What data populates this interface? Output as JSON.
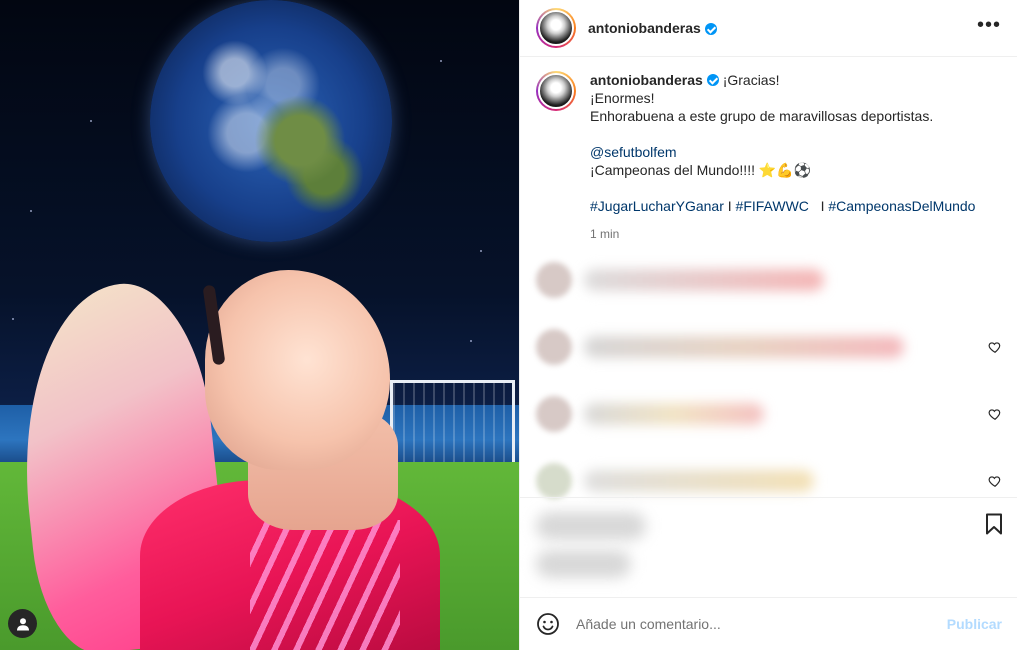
{
  "post": {
    "username": "antoniobanderas",
    "verified": true,
    "more_icon": "more-horizontal-icon"
  },
  "caption": {
    "username": "antoniobanderas",
    "line1": "¡Gracias!",
    "line2": "¡Enormes!",
    "line3": "Enhorabuena a este grupo de maravillosas deportistas.",
    "mention": "@sefutbolfem",
    "line4": "¡Campeonas del Mundo!!!! ⭐💪⚽",
    "hashtag1": "#JugarLucharYGanar",
    "sep1": " I ",
    "hashtag2": "#FIFAWWC",
    "sep2": " I ",
    "hashtag3": "#CampeonasDelMundo",
    "time": "1 min"
  },
  "comments": {
    "like_icon": "heart-icon",
    "count_visible": 4
  },
  "actions": {
    "save_icon": "bookmark-icon"
  },
  "composer": {
    "emoji_icon": "emoji-icon",
    "placeholder": "Añade un comentario...",
    "publish_label": "Publicar"
  },
  "media": {
    "profile_icon": "user-icon"
  },
  "colors": {
    "link": "#00376b",
    "verified": "#0095f6",
    "publish_disabled": "#b3dbff",
    "muted": "#737373"
  }
}
